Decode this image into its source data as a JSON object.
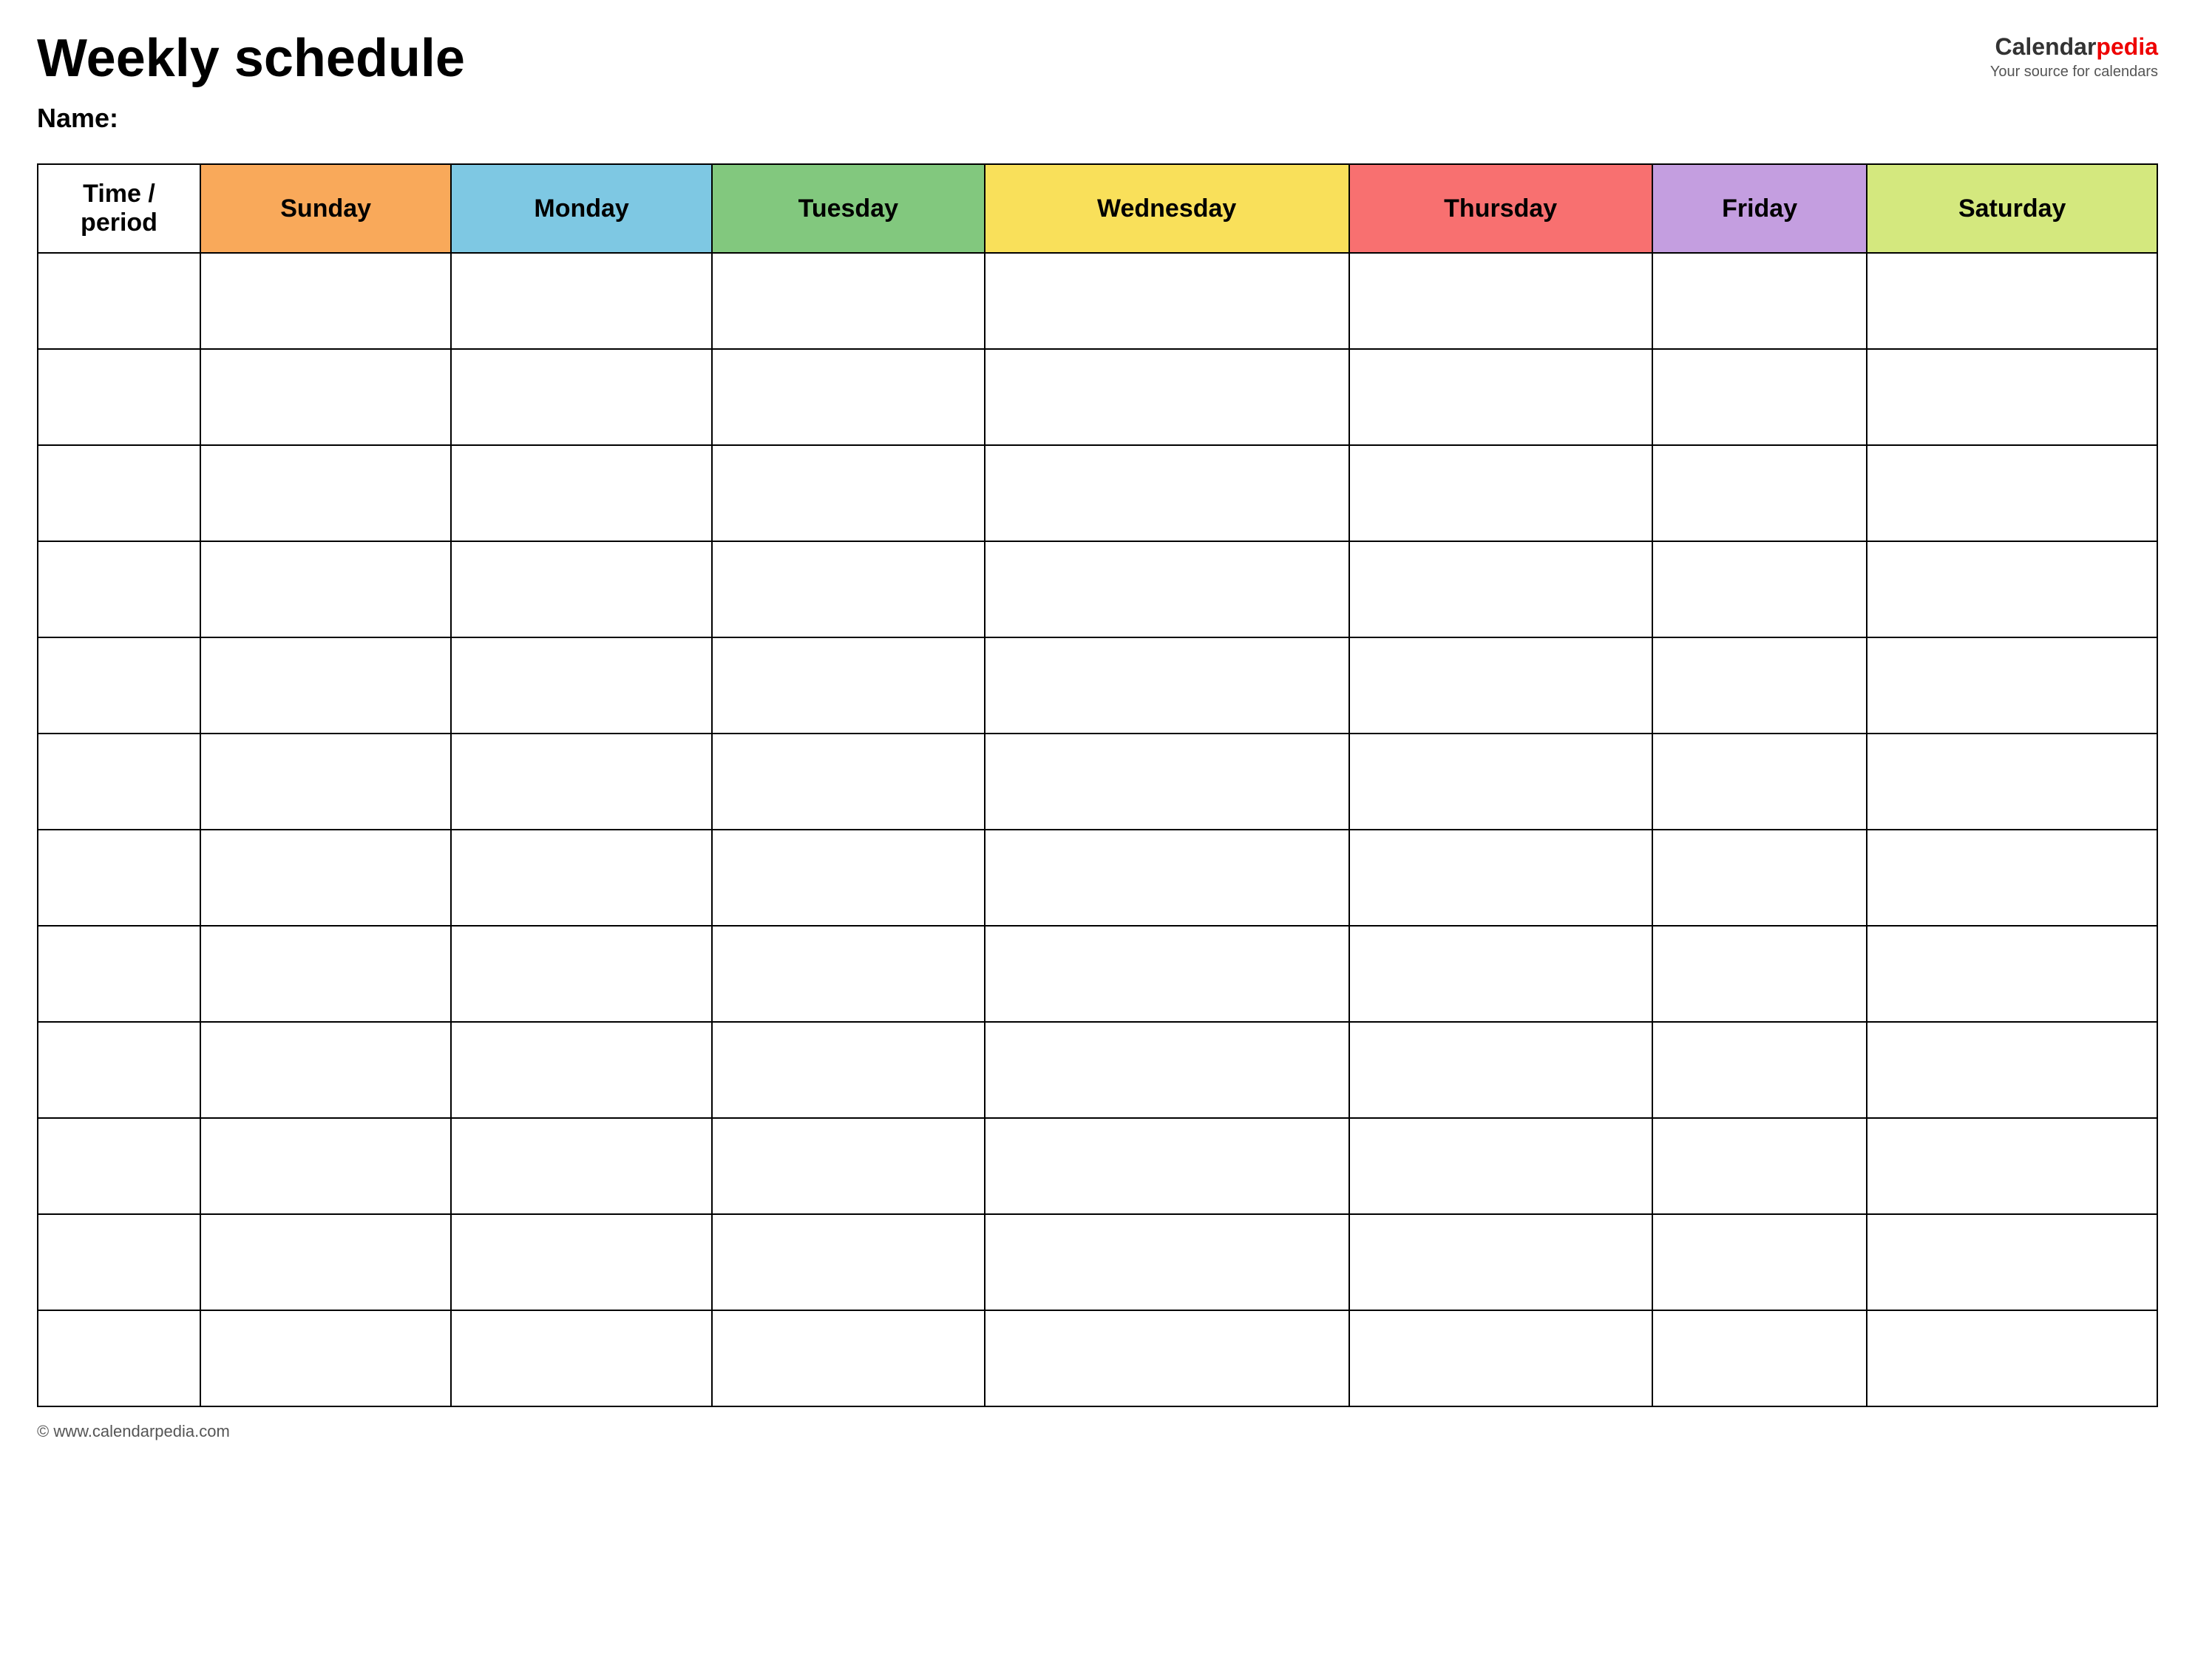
{
  "header": {
    "title": "Weekly schedule",
    "name_label": "Name:",
    "logo_brand": "Calendar",
    "logo_brand_red": "pedia",
    "logo_tagline": "Your source for calendars"
  },
  "table": {
    "columns": [
      {
        "key": "time",
        "label": "Time / period",
        "color": "#ffffff"
      },
      {
        "key": "sunday",
        "label": "Sunday",
        "color": "#f9a95a"
      },
      {
        "key": "monday",
        "label": "Monday",
        "color": "#7ec8e3"
      },
      {
        "key": "tuesday",
        "label": "Tuesday",
        "color": "#82c87e"
      },
      {
        "key": "wednesday",
        "label": "Wednesday",
        "color": "#f9e05a"
      },
      {
        "key": "thursday",
        "label": "Thursday",
        "color": "#f87070"
      },
      {
        "key": "friday",
        "label": "Friday",
        "color": "#c49ee0"
      },
      {
        "key": "saturday",
        "label": "Saturday",
        "color": "#d4e87e"
      }
    ],
    "row_count": 12
  },
  "footer": {
    "url": "www.calendarpedia.com"
  }
}
